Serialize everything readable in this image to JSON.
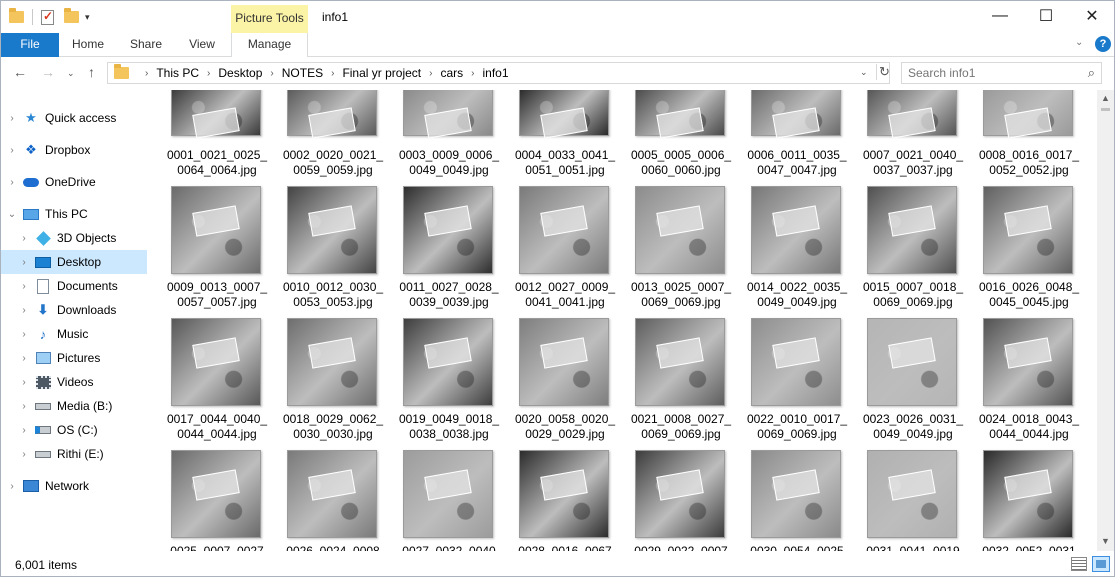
{
  "window": {
    "title": "info1",
    "context_tab_header": "Picture Tools",
    "controls": [
      "—",
      "☐",
      "✕"
    ]
  },
  "ribbon": {
    "tabs": [
      "File",
      "Home",
      "Share",
      "View",
      "Manage"
    ]
  },
  "address": {
    "breadcrumbs": [
      "This PC",
      "Desktop",
      "NOTES",
      "Final yr project",
      "cars",
      "info1"
    ],
    "search_placeholder": "Search info1"
  },
  "nav": {
    "items": [
      {
        "label": "Quick access",
        "icon": "star-icon"
      },
      {
        "label": "Dropbox",
        "icon": "dropbox-icon"
      },
      {
        "label": "OneDrive",
        "icon": "cloud-icon"
      },
      {
        "label": "This PC",
        "icon": "computer-icon"
      },
      {
        "label": "3D Objects",
        "icon": "cube-icon"
      },
      {
        "label": "Desktop",
        "icon": "desktop-icon"
      },
      {
        "label": "Documents",
        "icon": "document-icon"
      },
      {
        "label": "Downloads",
        "icon": "download-icon"
      },
      {
        "label": "Music",
        "icon": "music-icon"
      },
      {
        "label": "Pictures",
        "icon": "pictures-icon"
      },
      {
        "label": "Videos",
        "icon": "videos-icon"
      },
      {
        "label": "Media (B:)",
        "icon": "drive-icon"
      },
      {
        "label": "OS (C:)",
        "icon": "windows-drive-icon"
      },
      {
        "label": "Rithi (E:)",
        "icon": "drive-icon"
      },
      {
        "label": "Network",
        "icon": "network-icon"
      }
    ],
    "selected": "Desktop"
  },
  "files": [
    {
      "line1": "0001_0021_0025_",
      "line2": "0064_0064.jpg",
      "shade": "#3a3a3a"
    },
    {
      "line1": "0002_0020_0021_",
      "line2": "0059_0059.jpg",
      "shade": "#5a5a5a"
    },
    {
      "line1": "0003_0009_0006_",
      "line2": "0049_0049.jpg",
      "shade": "#8a8a8a"
    },
    {
      "line1": "0004_0033_0041_",
      "line2": "0051_0051.jpg",
      "shade": "#2a2a2a"
    },
    {
      "line1": "0005_0005_0006_",
      "line2": "0060_0060.jpg",
      "shade": "#4a4a4a"
    },
    {
      "line1": "0006_0011_0035_",
      "line2": "0047_0047.jpg",
      "shade": "#6a6a6a"
    },
    {
      "line1": "0007_0021_0040_",
      "line2": "0037_0037.jpg",
      "shade": "#555555"
    },
    {
      "line1": "0008_0016_0017_",
      "line2": "0052_0052.jpg",
      "shade": "#9a9a9a"
    },
    {
      "line1": "0009_0013_0007_",
      "line2": "0057_0057.jpg",
      "shade": "#6b6b6b"
    },
    {
      "line1": "0010_0012_0030_",
      "line2": "0053_0053.jpg",
      "shade": "#444444"
    },
    {
      "line1": "0011_0027_0028_",
      "line2": "0039_0039.jpg",
      "shade": "#2e2e2e"
    },
    {
      "line1": "0012_0027_0009_",
      "line2": "0041_0041.jpg",
      "shade": "#7a7a7a"
    },
    {
      "line1": "0013_0025_0007_",
      "line2": "0069_0069.jpg",
      "shade": "#8c8c8c"
    },
    {
      "line1": "0014_0022_0035_",
      "line2": "0049_0049.jpg",
      "shade": "#777777"
    },
    {
      "line1": "0015_0007_0018_",
      "line2": "0069_0069.jpg",
      "shade": "#505050"
    },
    {
      "line1": "0016_0026_0048_",
      "line2": "0045_0045.jpg",
      "shade": "#606060"
    },
    {
      "line1": "0017_0044_0040_",
      "line2": "0044_0044.jpg",
      "shade": "#585858"
    },
    {
      "line1": "0018_0029_0062_",
      "line2": "0030_0030.jpg",
      "shade": "#6e6e6e"
    },
    {
      "line1": "0019_0049_0018_",
      "line2": "0038_0038.jpg",
      "shade": "#3e3e3e"
    },
    {
      "line1": "0020_0058_0020_",
      "line2": "0029_0029.jpg",
      "shade": "#7e7e7e"
    },
    {
      "line1": "0021_0008_0027_",
      "line2": "0069_0069.jpg",
      "shade": "#5e5e5e"
    },
    {
      "line1": "0022_0010_0017_",
      "line2": "0069_0069.jpg",
      "shade": "#8e8e8e"
    },
    {
      "line1": "0023_0026_0031_",
      "line2": "0049_0049.jpg",
      "shade": "#b5b5b5"
    },
    {
      "line1": "0024_0018_0043_",
      "line2": "0044_0044.jpg",
      "shade": "#525252"
    },
    {
      "line1": "0025_0007_0027",
      "line2": "",
      "shade": "#6a6a6a"
    },
    {
      "line1": "0026_0024_0008",
      "line2": "",
      "shade": "#7a7a7a"
    },
    {
      "line1": "0027_0032_0040",
      "line2": "",
      "shade": "#9c9c9c"
    },
    {
      "line1": "0028_0016_0067",
      "line2": "",
      "shade": "#2c2c2c"
    },
    {
      "line1": "0029_0022_0007",
      "line2": "",
      "shade": "#3c3c3c"
    },
    {
      "line1": "0030_0054_0025",
      "line2": "",
      "shade": "#8a8a8a"
    },
    {
      "line1": "0031_0041_0019",
      "line2": "",
      "shade": "#b0b0b0"
    },
    {
      "line1": "0032_0052_0031",
      "line2": "",
      "shade": "#2a2a2a"
    }
  ],
  "status": {
    "item_count": "6,001 items"
  }
}
